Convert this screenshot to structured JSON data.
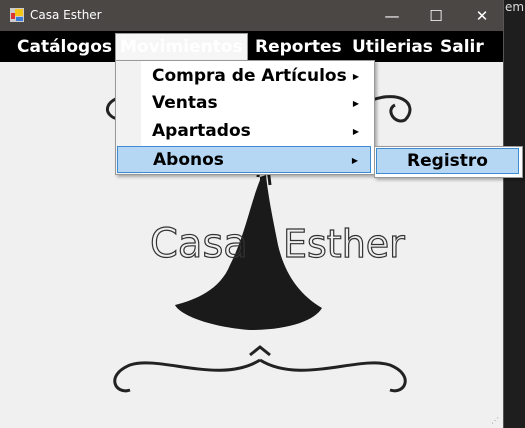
{
  "window": {
    "title": "Casa Esther",
    "minimize": "—",
    "maximize": "☐",
    "close": "✕"
  },
  "background_text": "em",
  "menubar": {
    "items": [
      {
        "label": "Catálogos"
      },
      {
        "label": "Movimientos"
      },
      {
        "label": "Reportes"
      },
      {
        "label": "Utilerias"
      },
      {
        "label": "Salir"
      }
    ]
  },
  "dropdown": {
    "items": [
      {
        "label": "Compra de Artículos"
      },
      {
        "label": "Ventas"
      },
      {
        "label": "Apartados"
      },
      {
        "label": "Abonos"
      }
    ],
    "arrow": "▶"
  },
  "submenu": {
    "items": [
      {
        "label": "Registro"
      }
    ]
  },
  "logo": {
    "text_left": "Casa",
    "text_right": "Esther"
  },
  "colors": {
    "highlight": "#b5d7f3",
    "highlight_border": "#3d8bd0",
    "titlebar": "#4a4745",
    "menubar": "#000000"
  }
}
